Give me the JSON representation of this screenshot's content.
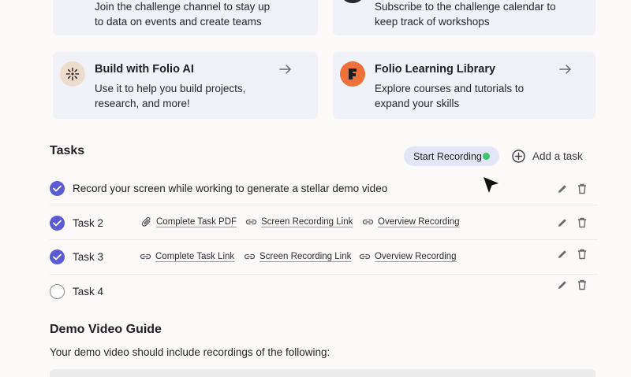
{
  "top_cards": [
    {
      "text_line1": "Join the challenge channel to stay up",
      "text_line2": "to data on events and create teams"
    },
    {
      "text_line1": "Subscribe to the challenge calendar to",
      "text_line2": "keep track of workshops"
    }
  ],
  "cards": [
    {
      "title": "Build with Folio AI",
      "desc_line1": "Use it to help you build projects,",
      "desc_line2": "research, and more!",
      "icon": "sparkle-icon"
    },
    {
      "title": "Folio Learning Library",
      "desc_line1": "Explore courses and tutorials to",
      "desc_line2": "expand your skills",
      "icon": "folio-logo-icon"
    }
  ],
  "tasks_section": {
    "heading": "Tasks",
    "start_recording_label": "Start Recording",
    "add_task_label": "Add a task"
  },
  "tasks": [
    {
      "label": "Record your screen while working to generate a stellar demo video",
      "done": true,
      "links": []
    },
    {
      "label": "Task 2",
      "done": true,
      "links": [
        {
          "icon": "paperclip-icon",
          "text": "Complete Task PDF"
        },
        {
          "icon": "link-icon",
          "text": "Screen Recording Link"
        },
        {
          "icon": "link-icon",
          "text": "Overview Recording"
        }
      ]
    },
    {
      "label": "Task 3",
      "done": true,
      "links": [
        {
          "icon": "link-icon",
          "text": "Complete Task Link"
        },
        {
          "icon": "link-icon",
          "text": "Screen Recording Link"
        },
        {
          "icon": "link-icon",
          "text": "Overview Recording"
        }
      ]
    },
    {
      "label": "Task 4",
      "done": false,
      "links": []
    }
  ],
  "guide": {
    "heading": "Demo Video Guide",
    "subtext": "Your demo video should include recordings of the following:"
  },
  "colors": {
    "accent": "#5b5bd6",
    "card_bg": "#f1f2f8",
    "recording_dot": "#3ec46d",
    "folio_orange": "#f0703a"
  }
}
